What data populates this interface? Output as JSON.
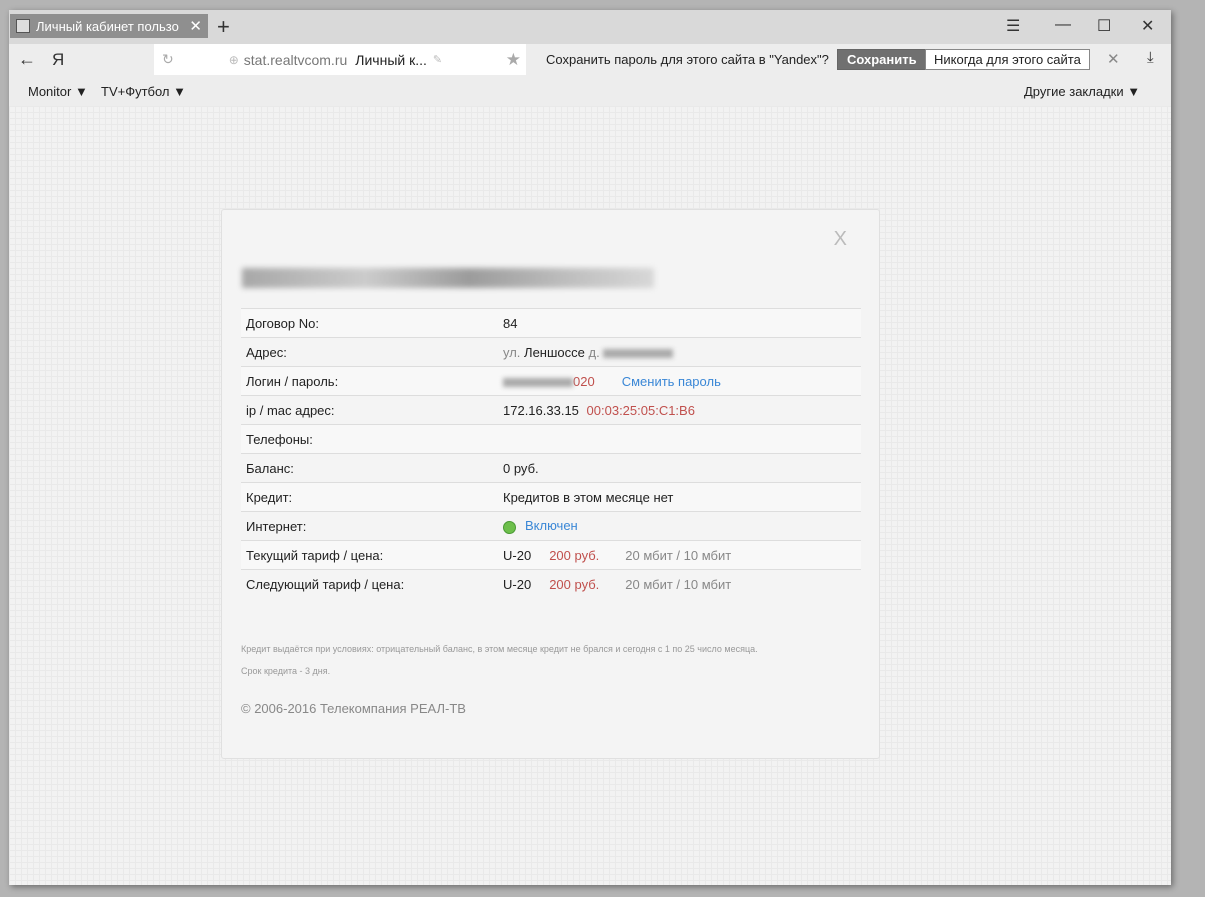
{
  "browser": {
    "tab_title": "Личный кабинет пользо",
    "url_host": "stat.realtvcom.ru",
    "url_title": "Личный к...",
    "save_prompt": "Сохранить пароль для этого сайта в \"Yandex\"?",
    "save_label": "Сохранить",
    "never_label": "Никогда для этого сайта",
    "bookmarks": [
      "Monitor ▼",
      "TV+Футбол ▼"
    ],
    "other_bookmarks": "Другие закладки ▼",
    "logo": "Я"
  },
  "card": {
    "close": "X",
    "rows": [
      {
        "label": "Договор No:",
        "value": "84"
      },
      {
        "label": "Адрес:",
        "prefix": "ул.",
        "value": "Леншоссе",
        "suffix": "д."
      },
      {
        "label": "Логин / пароль:",
        "value": "020",
        "link": "Сменить пароль"
      },
      {
        "label": "ip / mac адрес:",
        "value": "172.16.33.15",
        "extra": "00:03:25:05:C1:B6"
      },
      {
        "label": "Телефоны:",
        "value": ""
      },
      {
        "label": "Баланс:",
        "value": "0 руб."
      },
      {
        "label": "Кредит:",
        "value": "Кредитов в этом месяце нет"
      },
      {
        "label": "Интернет:",
        "value": "Включен"
      },
      {
        "label": "Текущий тариф / цена:",
        "value": "U-20",
        "price": "200 руб.",
        "speed": "20 мбит / 10 мбит"
      },
      {
        "label": "Следующий тариф / цена:",
        "value": "U-20",
        "price": "200 руб.",
        "speed": "20 мбит / 10 мбит"
      }
    ],
    "note1": "Кредит выдаётся при условиях: отрицательный баланс, в этом месяце кредит не брался и сегодня с 1 по 25 число месяца.",
    "note2": "Срок кредита - 3 дня.",
    "copyright": "© 2006-2016 Телекомпания РЕАЛ-ТВ"
  }
}
